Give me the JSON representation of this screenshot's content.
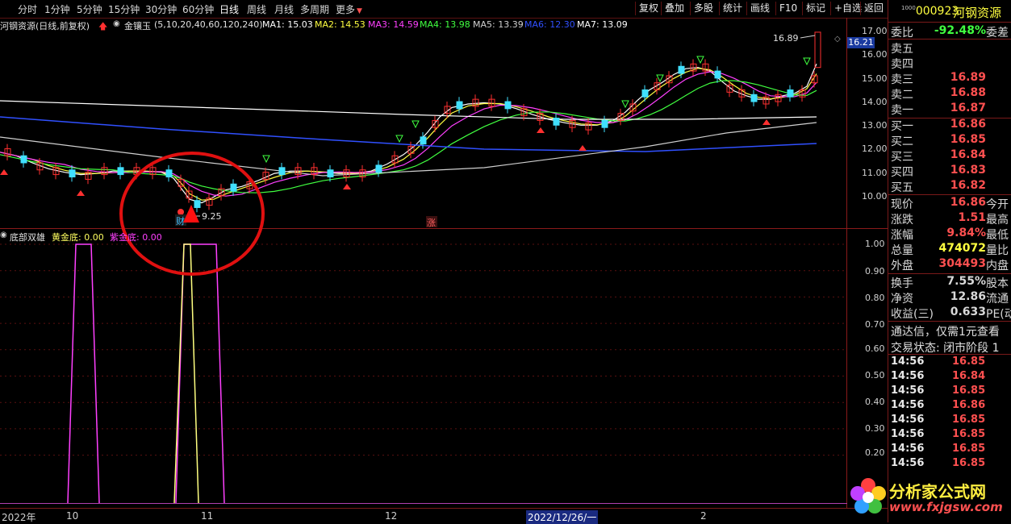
{
  "toolbar": {
    "periods": [
      "分时",
      "1分钟",
      "5分钟",
      "15分钟",
      "30分钟",
      "60分钟",
      "日线",
      "周线",
      "月线",
      "多周期",
      "更多"
    ],
    "active_period": "日线",
    "buttons": [
      "复权",
      "叠加",
      "多股",
      "统计",
      "画线",
      "F10",
      "标记",
      "+自选",
      "返回"
    ]
  },
  "info_line": {
    "stock_title": "河钢资源(日线,前复权)",
    "indicator_name": "金镶玉",
    "indicator_params": "(5,10,20,40,60,120,240)",
    "ma": [
      {
        "label": "MA1: 15.03",
        "color": "#ffffff"
      },
      {
        "label": "MA2: 14.53",
        "color": "#ffff40"
      },
      {
        "label": "MA3: 14.59",
        "color": "#ff40ff"
      },
      {
        "label": "MA4: 13.98",
        "color": "#40ff40"
      },
      {
        "label": "MA5: 13.39",
        "color": "#d0d0d0"
      },
      {
        "label": "MA6: 12.30",
        "color": "#3050ff"
      },
      {
        "label": "MA7: 13.09",
        "color": "#ffffff"
      }
    ]
  },
  "price_axis": {
    "labels": [
      "17.00",
      "16.00",
      "15.00",
      "14.00",
      "13.00",
      "12.00",
      "11.00",
      "10.00"
    ],
    "current_price_tag": "16.21",
    "high_label": "16.89",
    "low_label": "9.25"
  },
  "chart_marks": {
    "cai_label": "财",
    "zhang_label": "涨"
  },
  "lower_pane": {
    "title": "底部双雄",
    "gold_label": "黄金底: 0.00",
    "purple_label": "紫金底: 0.00",
    "axis": [
      "1.00",
      "0.90",
      "0.80",
      "0.70",
      "0.60",
      "0.50",
      "0.40",
      "0.30",
      "0.20"
    ]
  },
  "date_axis": {
    "labels": [
      "2022年",
      "10",
      "11",
      "12",
      "2022/12/26/一",
      "2"
    ]
  },
  "quote_panel": {
    "code": "000923",
    "name": "河钢资源",
    "weibi_label": "委比",
    "weibi_value": "-92.48%",
    "weicha_label": "委差",
    "sell": [
      {
        "label": "卖五",
        "price": ""
      },
      {
        "label": "卖四",
        "price": ""
      },
      {
        "label": "卖三",
        "price": "16.89"
      },
      {
        "label": "卖二",
        "price": "16.88"
      },
      {
        "label": "卖一",
        "price": "16.87"
      }
    ],
    "buy": [
      {
        "label": "买一",
        "price": "16.86"
      },
      {
        "label": "买二",
        "price": "16.85"
      },
      {
        "label": "买三",
        "price": "16.84"
      },
      {
        "label": "买四",
        "price": "16.83"
      },
      {
        "label": "买五",
        "price": "16.82"
      }
    ],
    "stats": [
      {
        "label": "现价",
        "value": "16.86",
        "ext": "今开",
        "color": "#ff5050"
      },
      {
        "label": "涨跌",
        "value": "1.51",
        "ext": "最高",
        "color": "#ff5050"
      },
      {
        "label": "涨幅",
        "value": "9.84%",
        "ext": "最低",
        "color": "#ff5050"
      },
      {
        "label": "总量",
        "value": "474072",
        "ext": "量比",
        "color": "#ffff40"
      },
      {
        "label": "外盘",
        "value": "304493",
        "ext": "内盘",
        "color": "#ff5050"
      }
    ],
    "stats2": [
      {
        "label": "换手",
        "value": "7.55%",
        "ext": "股本",
        "color": "#d8d8d8"
      },
      {
        "label": "净资",
        "value": "12.86",
        "ext": "流通",
        "color": "#d8d8d8"
      },
      {
        "label": "收益(三)",
        "value": "0.633",
        "ext": "PE(动",
        "color": "#d8d8d8"
      }
    ],
    "notice": "通达信，仅需1元查看",
    "trade_status": "交易状态: 闭市阶段 1",
    "ticks": [
      {
        "time": "14:56",
        "price": "16.85"
      },
      {
        "time": "14:56",
        "price": "16.84"
      },
      {
        "time": "14:56",
        "price": "16.85"
      },
      {
        "time": "14:56",
        "price": "16.86"
      },
      {
        "time": "14:56",
        "price": "16.85"
      },
      {
        "time": "14:56",
        "price": "16.85"
      },
      {
        "time": "14:56",
        "price": "16.85"
      },
      {
        "time": "14:56",
        "price": "16.85"
      }
    ]
  },
  "watermark": {
    "title": "分析家公式网",
    "url": "www.fxjgsw.com"
  },
  "colors": {
    "up": "#ff3030",
    "down": "#40e0ff",
    "frame": "#7a1a1a",
    "highlight_circle": "#e01010"
  }
}
